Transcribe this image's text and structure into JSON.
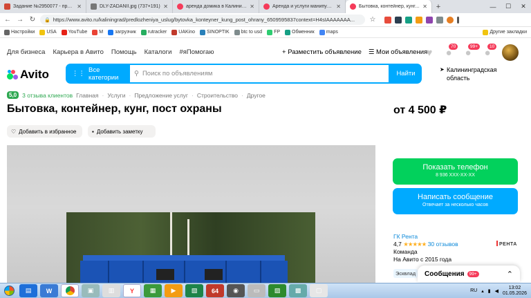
{
  "browser": {
    "tabs": [
      {
        "label": "Задание №2950077 - просмо",
        "icon": "sp-icon",
        "color": "#d14836"
      },
      {
        "label": "DLY-ZADANII.jpg (737×191)",
        "icon": "image-icon",
        "color": "#777777"
      },
      {
        "label": "аренда домика в Калинингра",
        "icon": "avito-icon",
        "color": "#f53b5a"
      },
      {
        "label": "Аренда и услуги манипулятор",
        "icon": "avito-icon",
        "color": "#f53b5a"
      },
      {
        "label": "Бытовка, контейнер, кунг, по",
        "icon": "avito-icon",
        "color": "#f53b5a",
        "active": true
      }
    ],
    "url": "https://www.avito.ru/kaliningrad/predlozheniya_uslug/bytovka_konteyner_kung_post_ohrany_6509595837context=H4sIAAAAAAA...",
    "bookmarks": [
      "Настройки",
      "USA",
      "YouTube",
      "M",
      "загрузчик",
      "rutracker",
      "UAKino",
      "SINOPTIK",
      "btc to usd",
      "FP",
      "Обменник",
      "maps"
    ],
    "bookmarks_other": "Другие закладки"
  },
  "header": {
    "links": [
      "Для бизнеса",
      "Карьера в Авито",
      "Помощь",
      "Каталоги",
      "#яПомогаю"
    ],
    "post_ad": "Разместить объявление",
    "my_ads": "Мои объявления",
    "badges": {
      "favorites": "",
      "messages": "70",
      "notifications": "99+",
      "cart": "10"
    }
  },
  "search": {
    "logo": "Avito",
    "categories": "Все категории",
    "placeholder": "Поиск по объявлениям",
    "button": "Найти",
    "location": "Калининградская область"
  },
  "listing": {
    "rating": "5,0",
    "reviews": "3 отзыва клиентов",
    "breadcrumbs": [
      "Главная",
      "Услуги",
      "Предложение услуг",
      "Строительство",
      "Другое"
    ],
    "title": "Бытовка, контейнер, кунг, пост охраны",
    "price": "от 4 500 ₽",
    "favorite": "Добавить в избранное",
    "note": "Добавить заметку"
  },
  "contact": {
    "show_phone": "Показать телефон",
    "phone": "8 936 XXX-XX-XX",
    "message": "Написать сообщение",
    "message_sub": "Отвечает за несколько часов"
  },
  "seller": {
    "name": "ГК Рента",
    "rating": "4,7",
    "stars": "★★★★★",
    "reviews": "30 отзывов",
    "type": "Команда",
    "since": "На Авито с 2015 года",
    "logo": "РЕНТА",
    "tag": "Эсквлад"
  },
  "messenger": {
    "label": "Сообщения",
    "badge": "99+"
  },
  "taskbar": {
    "lang": "RU",
    "time": "13:02",
    "date": "01.05.2026"
  }
}
